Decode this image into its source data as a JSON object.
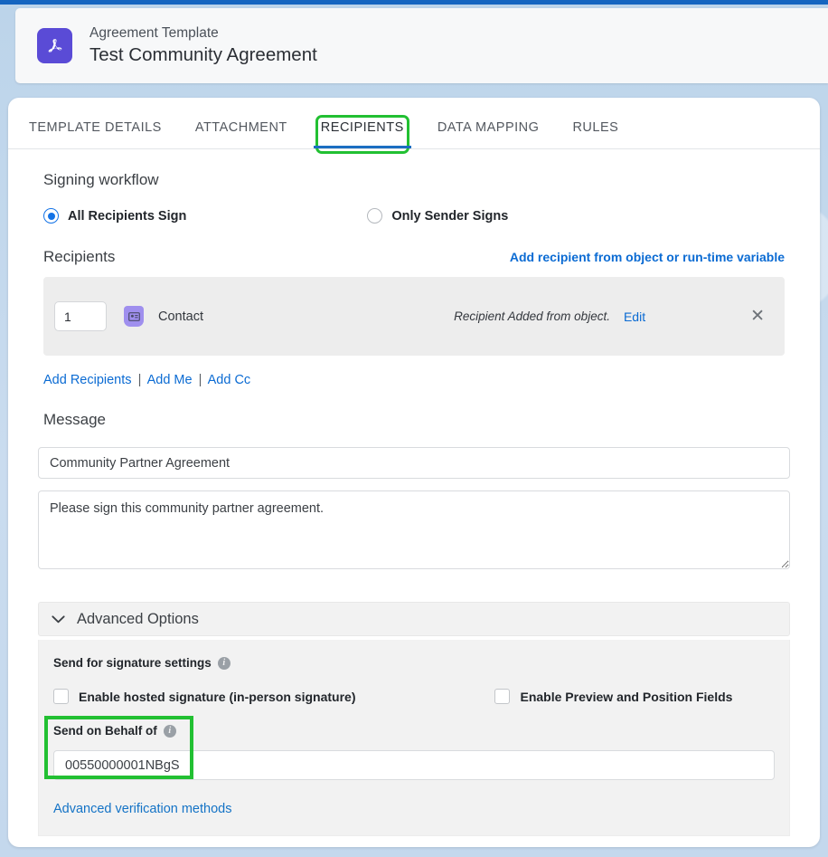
{
  "header": {
    "icon": "acrobat-pdf-icon",
    "eyebrow": "Agreement Template",
    "title": "Test Community Agreement"
  },
  "tabs": [
    {
      "label": "TEMPLATE DETAILS",
      "active": false,
      "highlighted": false
    },
    {
      "label": "ATTACHMENT",
      "active": false,
      "highlighted": false
    },
    {
      "label": "RECIPIENTS",
      "active": true,
      "highlighted": true
    },
    {
      "label": "DATA MAPPING",
      "active": false,
      "highlighted": false
    },
    {
      "label": "RULES",
      "active": false,
      "highlighted": false
    }
  ],
  "signing_workflow": {
    "heading": "Signing workflow",
    "options": [
      {
        "label": "All Recipients Sign",
        "selected": true
      },
      {
        "label": "Only Sender Signs",
        "selected": false
      }
    ]
  },
  "recipients": {
    "heading": "Recipients",
    "add_from_object_link": "Add recipient from object or run-time variable",
    "rows": [
      {
        "order": "1",
        "type_icon": "contact-card-icon",
        "name": "Contact",
        "status": "Recipient Added from object.",
        "edit_label": "Edit",
        "remove_icon": "close-icon"
      }
    ],
    "links": {
      "add_recipients": "Add Recipients",
      "separator": "|",
      "add_me": "Add Me",
      "add_cc": "Add Cc"
    }
  },
  "message": {
    "heading": "Message",
    "subject_value": "Community Partner Agreement",
    "subject_placeholder": "",
    "body_value": "Please sign this community partner agreement.",
    "body_placeholder": ""
  },
  "advanced_options": {
    "title": "Advanced Options",
    "chevron_icon": "chevron-down-icon",
    "expanded": true,
    "signature_settings_label": "Send for signature settings",
    "signature_settings_info_icon": "info-icon",
    "checkboxes": [
      {
        "label": "Enable hosted signature (in-person signature)",
        "checked": false
      },
      {
        "label": "Enable Preview and Position Fields",
        "checked": false
      }
    ],
    "send_on_behalf": {
      "label": "Send on Behalf of",
      "info_icon": "info-icon",
      "value": "00550000001NBgS",
      "placeholder": "",
      "highlighted": true
    },
    "advanced_verification_link": "Advanced verification methods"
  },
  "colors": {
    "page_background": "#c3d9ee",
    "top_strip": "#1565c0",
    "accent_blue": "#0b6bd3",
    "tab_underline": "#1b6ec2",
    "highlight_green": "#22c032",
    "acrobat_purple": "#5a4bd6",
    "recipient_panel": "#ededed",
    "advanced_panel": "#f2f2f2"
  }
}
